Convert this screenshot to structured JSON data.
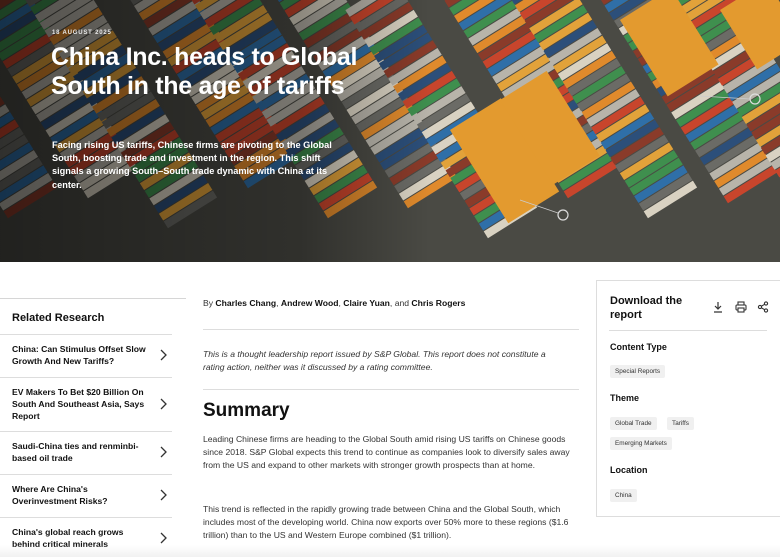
{
  "hero": {
    "date": "18 AUGUST 2025",
    "title": "China Inc. heads to Global South in the age of tariffs",
    "dek": "Facing rising US tariffs, Chinese firms are pivoting to the Global South, boosting trade and investment in the region. This shift signals a growing South–South trade dynamic with China at its center."
  },
  "related": {
    "heading": "Related Research",
    "items": [
      {
        "label": "China: Can Stimulus Offset Slow Growth And New Tariffs?"
      },
      {
        "label": "EV Makers To Bet $20 Billion On South And Southeast Asia, Says Report"
      },
      {
        "label": "Saudi-China ties and renminbi-based oil trade"
      },
      {
        "label": "Where Are China's Overinvestment Risks?"
      },
      {
        "label": "China's global reach grows behind critical minerals"
      }
    ]
  },
  "article": {
    "by": "By",
    "authors_1": "Charles Chang",
    "authors_2": "Andrew Wood",
    "authors_3": "Claire Yuan",
    "and": "and",
    "authors_4": "Chris Rogers",
    "disclaimer": "This is a thought leadership report issued by S&P Global. This report does not constitute a rating action, neither was it discussed by a rating committee.",
    "summary_heading": "Summary",
    "para1": "Leading Chinese firms are heading to the Global South amid rising US tariffs on Chinese goods since 2018. S&P Global expects this trend to continue as companies look to diversify sales away from the US and expand to other markets with stronger growth prospects than at home.",
    "para2": "This trend is reflected in the rapidly growing trade between China and the Global South, which includes most of the developing world. China now exports over 50% more to these regions ($1.6 trillion) than to the US and Western Europe combined ($1 trillion)."
  },
  "panel": {
    "download_title": "Download the report",
    "content_type_label": "Content Type",
    "content_types": [
      "Special Reports"
    ],
    "theme_label": "Theme",
    "themes": [
      "Global Trade",
      "Tariffs",
      "Emerging Markets"
    ],
    "location_label": "Location",
    "locations": [
      "China"
    ]
  },
  "icons": {
    "download": "download-icon",
    "print": "print-icon",
    "share": "share-icon",
    "chevron": "chevron-right-icon"
  }
}
